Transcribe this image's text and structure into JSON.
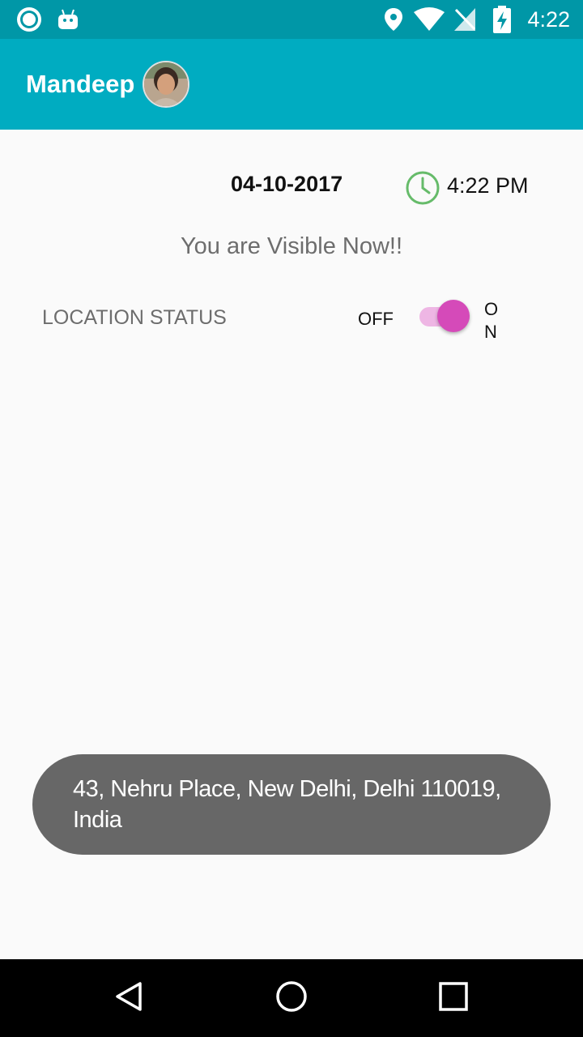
{
  "status_bar": {
    "time": "4:22",
    "icons": [
      "notification-ring-icon",
      "android-icon",
      "location-icon",
      "wifi-icon",
      "no-sim-icon",
      "battery-charging-icon"
    ]
  },
  "app_bar": {
    "title": "Mandeep",
    "avatar": "profile-photo"
  },
  "datetime": {
    "date": "04-10-2017",
    "time": "4:22 PM",
    "clock_color": "#66bb6a"
  },
  "visibility_message": "You are Visible Now!!",
  "location": {
    "label": "LOCATION STATUS",
    "off_label": "OFF",
    "on_label": "ON",
    "switch_on": true,
    "accent": "#d54ab9"
  },
  "toast": {
    "text": "43, Nehru Place, New Delhi, Delhi 110019, India"
  },
  "nav_bar": {
    "buttons": [
      "back-icon",
      "home-icon",
      "recents-icon"
    ]
  },
  "colors": {
    "status_bar": "#0097a7",
    "app_bar": "#00acc1",
    "background": "#fafafa",
    "toast_bg": "#676767"
  }
}
